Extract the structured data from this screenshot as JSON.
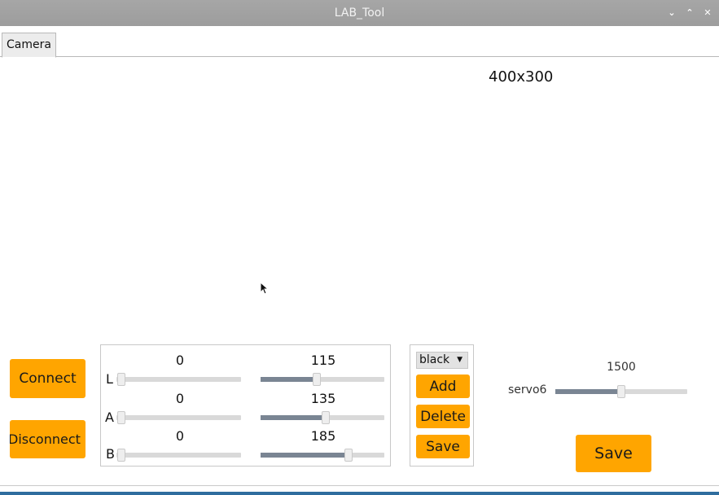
{
  "window": {
    "title": "LAB_Tool"
  },
  "tabs": [
    {
      "label": "Camera"
    }
  ],
  "camera": {
    "resolution": "400x300"
  },
  "connection": {
    "connect_label": "Connect",
    "disconnect_label": "Disconnect"
  },
  "lab": {
    "range": [
      0,
      255
    ],
    "channels": [
      {
        "name": "L",
        "min": {
          "value": "0"
        },
        "max": {
          "value": "115"
        }
      },
      {
        "name": "A",
        "min": {
          "value": "0"
        },
        "max": {
          "value": "135"
        }
      },
      {
        "name": "B",
        "min": {
          "value": "0"
        },
        "max": {
          "value": "185"
        }
      }
    ]
  },
  "color": {
    "selected": "black",
    "add_label": "Add",
    "delete_label": "Delete",
    "save_label": "Save"
  },
  "servo": {
    "name": "servo6",
    "value": "1500",
    "range": [
      500,
      2500
    ],
    "save_label": "Save"
  },
  "colors": {
    "accent": "#ffa500",
    "titlebar": "#a6a6a6",
    "slider_fill": "#7a8593"
  }
}
